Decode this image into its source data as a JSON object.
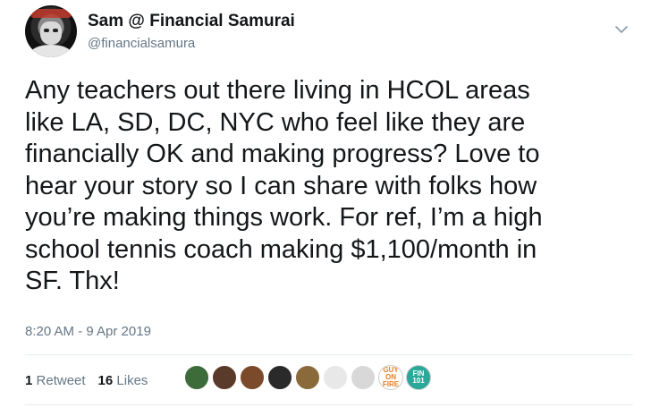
{
  "author": {
    "display_name": "Sam @ Financial Samurai",
    "handle": "@financialsamura"
  },
  "tweet": {
    "text": "Any teachers out there living in HCOL areas\nlike LA, SD, DC, NYC who feel like they are\nfinancially OK and making progress? Love to\nhear your story so I can share with folks how\nyou’re making things work. For ref, I’m a high\nschool tennis coach making $1,100/month in\nSF. Thx!",
    "timestamp": "8:20 AM - 9 Apr 2019"
  },
  "stats": {
    "retweets_count": "1",
    "retweets_label": "Retweet",
    "likes_count": "16",
    "likes_label": "Likes"
  },
  "likers": [
    {
      "name": "liker-avatar-1",
      "color": "#3d6b3a"
    },
    {
      "name": "liker-avatar-2",
      "color": "#5a3a2a"
    },
    {
      "name": "liker-avatar-3",
      "color": "#7a4a2a"
    },
    {
      "name": "liker-avatar-4",
      "color": "#2a2a2a"
    },
    {
      "name": "liker-avatar-5",
      "color": "#8a6a3a"
    },
    {
      "name": "liker-avatar-6",
      "color": "#e8e8e8"
    },
    {
      "name": "liker-avatar-7",
      "color": "#d8d8d8"
    },
    {
      "name": "liker-avatar-8",
      "color": "#ffffff",
      "logo_text": "GUY ON FIRE"
    },
    {
      "name": "liker-avatar-9",
      "color": "#2aa89a",
      "logo_text": "FIN 101"
    }
  ],
  "icons": {
    "chevron": "chevron-down-icon"
  },
  "colors": {
    "text_primary": "#14171a",
    "text_secondary": "#657786",
    "divider": "#e6ecf0"
  }
}
